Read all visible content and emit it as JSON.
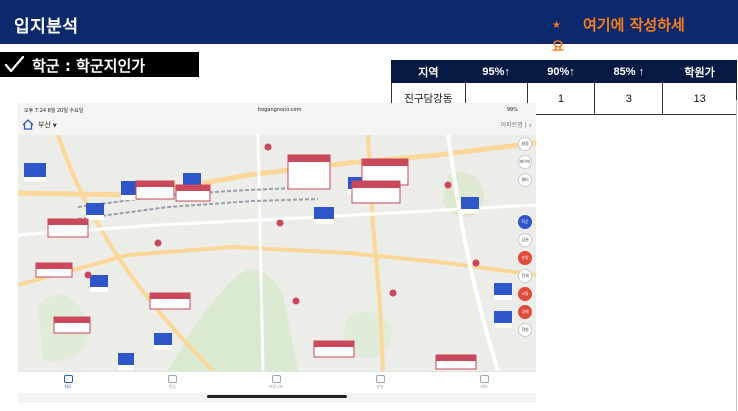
{
  "header": {
    "title": "입지분석",
    "note_star": "★",
    "note": "여기에 작성하세",
    "note_overflow": "요"
  },
  "subtitle": "학군 : 학군지인가",
  "colors": {
    "header_bg": "#0c2a6b",
    "note": "#f57c1f",
    "table_header": "#061a44",
    "label_pink": "#c9485b",
    "marker_blue": "#2f56c8"
  },
  "table": {
    "headers": [
      "지역",
      "95%↑",
      "90%↑",
      "85% ↑",
      "학원가"
    ],
    "row": [
      "진구담강동",
      "",
      "1",
      "3",
      "13"
    ]
  },
  "screenshot": {
    "status": {
      "time": "오후 7:24   8월 20일 수요일",
      "url": "hogangnono.com",
      "battery": "99%"
    },
    "region": "부산",
    "top_right": "아파트명  |",
    "map_labels": [
      "부산2동",
      "범일동",
      "부산진구",
      "전포동",
      "범천동",
      "가야1동",
      "당감2동",
      "부전동",
      "양정1동"
    ],
    "nav": [
      "지도",
      "관심",
      "커뮤니티",
      "분양",
      "마이"
    ],
    "side_buttons": [
      "설정",
      "레이어",
      "필터",
      "학군",
      "상권",
      "분양",
      "전세",
      "교통",
      "경매",
      "학원"
    ]
  }
}
